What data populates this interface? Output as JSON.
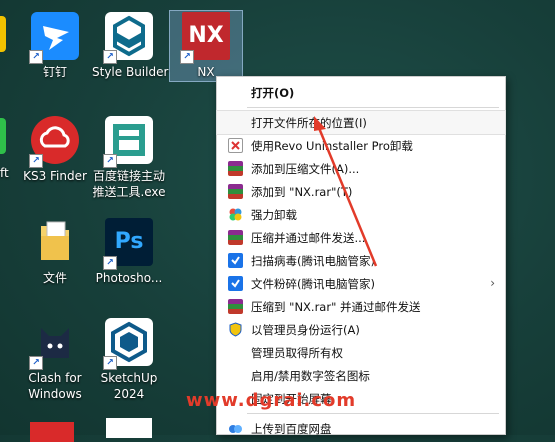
{
  "desktop": {
    "icons": [
      {
        "name": "icon-ding",
        "label": "钉钉"
      },
      {
        "name": "icon-style-builder",
        "label": "Style Builder"
      },
      {
        "name": "icon-nx",
        "label": "NX",
        "glyph": "NX"
      },
      {
        "name": "icon-ks3",
        "label": "KS3 Finder"
      },
      {
        "name": "icon-baidu-tool",
        "label1": "百度链接主动",
        "label2": "推送工具.exe"
      },
      {
        "name": "icon-folder",
        "label": "文件"
      },
      {
        "name": "icon-photoshop",
        "label": "Photosho...",
        "glyph": "Ps"
      },
      {
        "name": "icon-clash",
        "label1": "Clash for",
        "label2": "Windows"
      },
      {
        "name": "icon-sketchup",
        "label1": "SketchUp",
        "label2": "2024"
      }
    ],
    "left_edge_label": "ft"
  },
  "menu": {
    "items": [
      {
        "label": "打开(O)"
      },
      {
        "label": "打开文件所在的位置(I)"
      },
      {
        "label": "使用Revo Uninstaller Pro卸载"
      },
      {
        "label": "添加到压缩文件(A)..."
      },
      {
        "label": "添加到 \"NX.rar\"(T)"
      },
      {
        "label": "强力卸载"
      },
      {
        "label": "压缩并通过邮件发送..."
      },
      {
        "label": "扫描病毒(腾讯电脑管家)"
      },
      {
        "label": "文件粉碎(腾讯电脑管家)"
      },
      {
        "label": "压缩到 \"NX.rar\" 并通过邮件发送"
      },
      {
        "label": "以管理员身份运行(A)"
      },
      {
        "label": "管理员取得所有权"
      },
      {
        "label": "启用/禁用数字签名图标"
      },
      {
        "label": "固定到开始屏幕"
      },
      {
        "label": "上传到百度网盘"
      }
    ],
    "submenu_arrow": "›"
  },
  "watermark": "www.dgrai.com",
  "colors": {
    "annotation_arrow": "#e23b2a",
    "nx_red": "#c0282d",
    "ps_blue": "#31a8ff"
  }
}
